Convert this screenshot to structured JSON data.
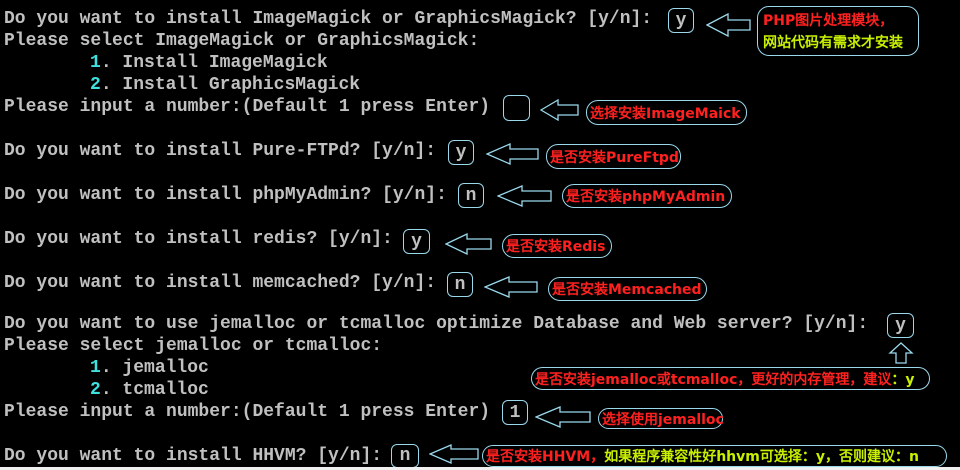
{
  "terminal": {
    "lines": [
      "Do you want to install ImageMagick or GraphicsMagick? [y/n]:",
      "Please select ImageMagick or GraphicsMagick:",
      "Install ImageMagick",
      "Install GraphicsMagick",
      "Please input a number:(Default 1 press Enter)",
      "Do you want to install Pure-FTPd? [y/n]:",
      "Do you want to install phpMyAdmin? [y/n]:",
      "Do you want to install redis? [y/n]:",
      "Do you want to install memcached? [y/n]:",
      "Do you want to use jemalloc or tcmalloc optimize Database and Web server? [y/n]:",
      "Please select jemalloc or tcmalloc:",
      "jemalloc",
      "tcmalloc",
      "Please input a number:(Default 1 press Enter)",
      "Do you want to install HHVM? [y/n]:"
    ],
    "option_numbers": [
      "1",
      "2"
    ],
    "answers": {
      "imagemagick": "y",
      "imagemagick_choice": "",
      "pureftpd": "y",
      "phpmyadmin": "n",
      "redis": "y",
      "memcached": "n",
      "jemalloc": "y",
      "jemalloc_choice": "1",
      "hhvm": "n"
    }
  },
  "annotations": {
    "imagemagick_1": "PHP图片处理模块，",
    "imagemagick_2": "网站代码有需求才安装",
    "imagemagick_choice": "选择安装ImageMaick",
    "pureftpd": "是否安装PureFtpd",
    "phpmyadmin": "是否安装phpMyAdmin",
    "redis": "是否安装Redis",
    "memcached": "是否安装Memcached",
    "jemalloc_red": "是否安装jemalloc或tcmalloc，更好的内存管理，建议",
    "jemalloc_green": "：y",
    "jemalloc_choice": "选择使用jemalloc",
    "hhvm_red": "是否安装HHVM，",
    "hhvm_green": "如果程序兼容性好hhvm可选择：y，否则建议：n"
  },
  "colors": {
    "annotation_red": "#ff2020",
    "annotation_green": "#c8f000",
    "outline": "#9ad8ec",
    "terminal_text": "#c0c0c0",
    "option_number": "#40e0e0"
  }
}
